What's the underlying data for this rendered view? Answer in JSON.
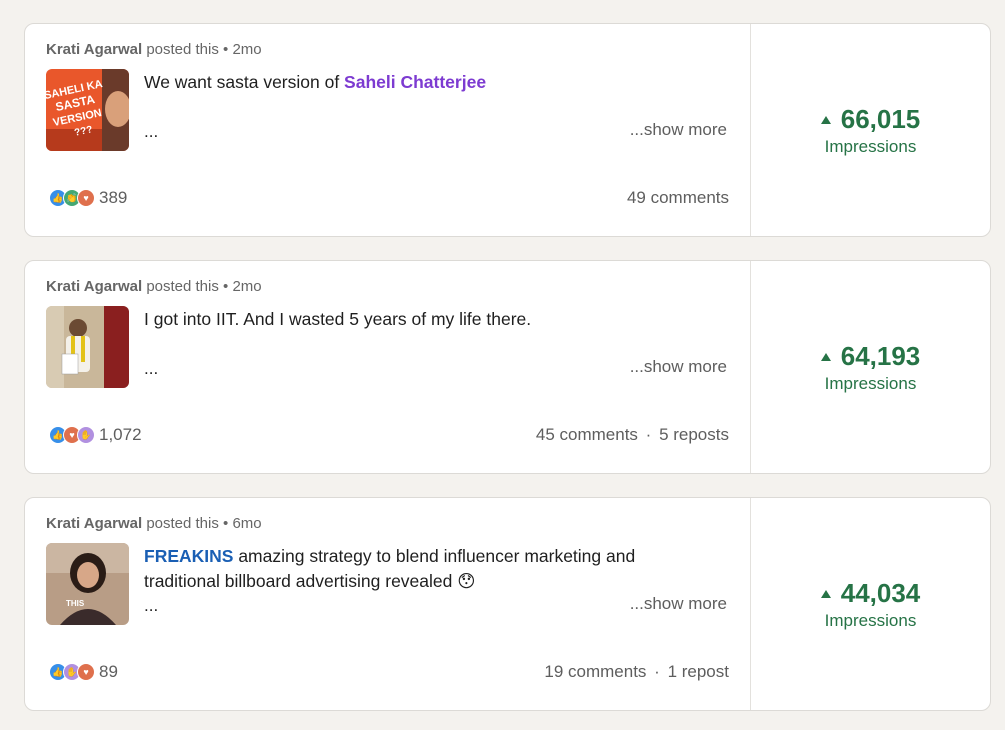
{
  "colors": {
    "impressions_green": "#267346",
    "mention_purple": "#7d3bd1",
    "mention_blue": "#1a5fb4",
    "reaction_like": "#378fe9",
    "reaction_celebrate": "#44a873",
    "reaction_love": "#df704d",
    "reaction_support": "#b190e0"
  },
  "posts": [
    {
      "author": "Krati Agarwal",
      "action": "posted this",
      "dot": "•",
      "time": "2mo",
      "thumb_text": "SAHELI KA SASTA VERSION ???",
      "text_before": "We want sasta version of ",
      "mention": "Saheli Chatterjee",
      "text_after": "",
      "ellipsis": "...",
      "show_more": "...show more",
      "reaction_icons": [
        "like-icon",
        "celebrate-icon",
        "love-icon"
      ],
      "reaction_count": "389",
      "comments": "49 comments",
      "reposts": "",
      "impressions_value": "66,015",
      "impressions_label": "Impressions"
    },
    {
      "author": "Krati Agarwal",
      "action": "posted this",
      "dot": "•",
      "time": "2mo",
      "text_before": "I got into IIT. And I wasted 5 years of my life there.",
      "mention": "",
      "text_after": "",
      "ellipsis": "...",
      "show_more": "...show more",
      "reaction_icons": [
        "like-icon",
        "love-icon",
        "support-icon"
      ],
      "reaction_count": "1,072",
      "comments": "45 comments",
      "repost_sep": "·",
      "reposts": "5 reposts",
      "impressions_value": "64,193",
      "impressions_label": "Impressions"
    },
    {
      "author": "Krati Agarwal",
      "action": "posted this",
      "dot": "•",
      "time": "6mo",
      "thumb_text": "THIS",
      "text_before": "",
      "mention": "FREAKINS",
      "text_after": " amazing strategy to blend influencer marketing and traditional billboard advertising revealed 😯",
      "ellipsis": "...",
      "show_more": "...show more",
      "reaction_icons": [
        "like-icon",
        "support-icon",
        "love-icon"
      ],
      "reaction_count": "89",
      "comments": "19 comments",
      "repost_sep": "·",
      "reposts": "1 repost",
      "impressions_value": "44,034",
      "impressions_label": "Impressions"
    }
  ]
}
